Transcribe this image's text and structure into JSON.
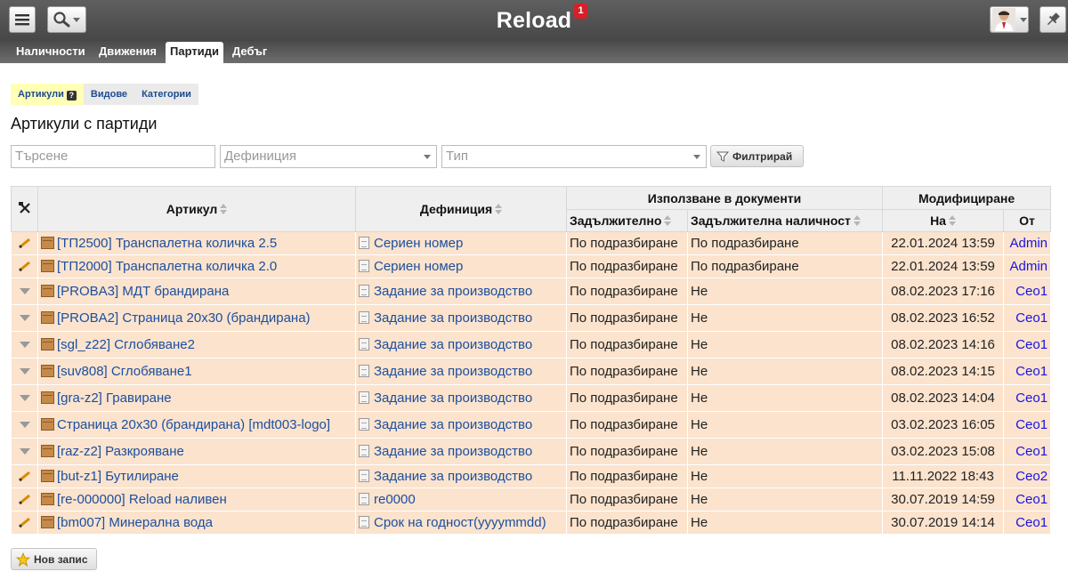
{
  "app": {
    "title": "Reload",
    "notification_count": "1"
  },
  "main_tabs": [
    {
      "label": "Наличности"
    },
    {
      "label": "Движения"
    },
    {
      "label": "Партиди"
    },
    {
      "label": "Дебъг"
    }
  ],
  "sub_tabs": [
    {
      "label": "Артикули"
    },
    {
      "label": "Видове"
    },
    {
      "label": "Категории"
    }
  ],
  "page_title": "Артикули с партиди",
  "filters": {
    "search_placeholder": "Търсене",
    "definition_placeholder": "Дефиниция",
    "type_placeholder": "Тип",
    "filter_button": "Филтрирай"
  },
  "table": {
    "headers": {
      "article": "Артикул",
      "definition": "Дефиниция",
      "usage_group": "Използване в документи",
      "mandatory": "Задължително",
      "mandatory_stock": "Задължителна наличност",
      "modified_group": "Модифициране",
      "on": "На",
      "by": "От"
    },
    "rows": [
      {
        "action": "edit",
        "article": "[ТП2500] Транспалетна количка 2.5",
        "definition": "Сериен номер",
        "mandatory": "По подразбиране",
        "mandatory_stock": "По подразбиране",
        "date": "22.01.2024 13:59",
        "user": "Admin"
      },
      {
        "action": "edit",
        "article": "[ТП2000] Транспалетна количка 2.0",
        "definition": "Сериен номер",
        "mandatory": "По подразбиране",
        "mandatory_stock": "По подразбиране",
        "date": "22.01.2024 13:59",
        "user": "Admin"
      },
      {
        "action": "menu",
        "article": "[PROBA3] МДТ брандирана",
        "definition": "Задание за производство",
        "mandatory": "По подразбиране",
        "mandatory_stock": "Не",
        "date": "08.02.2023 17:16",
        "user": "Ceo1"
      },
      {
        "action": "menu",
        "article": "[PROBA2] Страница 20х30 (брандирана)",
        "definition": "Задание за производство",
        "mandatory": "По подразбиране",
        "mandatory_stock": "Не",
        "date": "08.02.2023 16:52",
        "user": "Ceo1"
      },
      {
        "action": "menu",
        "article": "[sgl_z22] Сглобяване2",
        "definition": "Задание за производство",
        "mandatory": "По подразбиране",
        "mandatory_stock": "Не",
        "date": "08.02.2023 14:16",
        "user": "Ceo1"
      },
      {
        "action": "menu",
        "article": "[suv808] Сглобяване1",
        "definition": "Задание за производство",
        "mandatory": "По подразбиране",
        "mandatory_stock": "Не",
        "date": "08.02.2023 14:15",
        "user": "Ceo1"
      },
      {
        "action": "menu",
        "article": "[gra-z2] Гравиране",
        "definition": "Задание за производство",
        "mandatory": "По подразбиране",
        "mandatory_stock": "Не",
        "date": "08.02.2023 14:04",
        "user": "Ceo1"
      },
      {
        "action": "menu",
        "article": "Страница 20х30 (брандирана) [mdt003-logo]",
        "definition": "Задание за производство",
        "mandatory": "По подразбиране",
        "mandatory_stock": "Не",
        "date": "03.02.2023 16:05",
        "user": "Ceo1"
      },
      {
        "action": "menu",
        "article": "[raz-z2] Разкрояване",
        "definition": "Задание за производство",
        "mandatory": "По подразбиране",
        "mandatory_stock": "Не",
        "date": "03.02.2023 15:08",
        "user": "Ceo1"
      },
      {
        "action": "edit",
        "article": "[but-z1] Бутилиране",
        "definition": "Задание за производство",
        "mandatory": "По подразбиране",
        "mandatory_stock": "Не",
        "date": "11.11.2022 18:43",
        "user": "Ceo2"
      },
      {
        "action": "edit",
        "article": "[re-000000] Reload наливен",
        "definition": "re0000",
        "mandatory": "По подразбиране",
        "mandatory_stock": "Не",
        "date": "30.07.2019 14:59",
        "user": "Ceo1"
      },
      {
        "action": "edit",
        "article": "[bm007] Минерална вода",
        "definition": "Срок на годност(yyyymmdd)",
        "mandatory": "По подразбиране",
        "mandatory_stock": "Не",
        "date": "30.07.2019 14:14",
        "user": "Ceo1"
      }
    ]
  },
  "new_record_button": "Нов запис",
  "colors": {
    "row_bg": "#fbe3cd",
    "link": "#1c4fa0",
    "user_link": "#1a12e0",
    "badge": "#d6202a",
    "active_subtab": "#ffffb5"
  }
}
